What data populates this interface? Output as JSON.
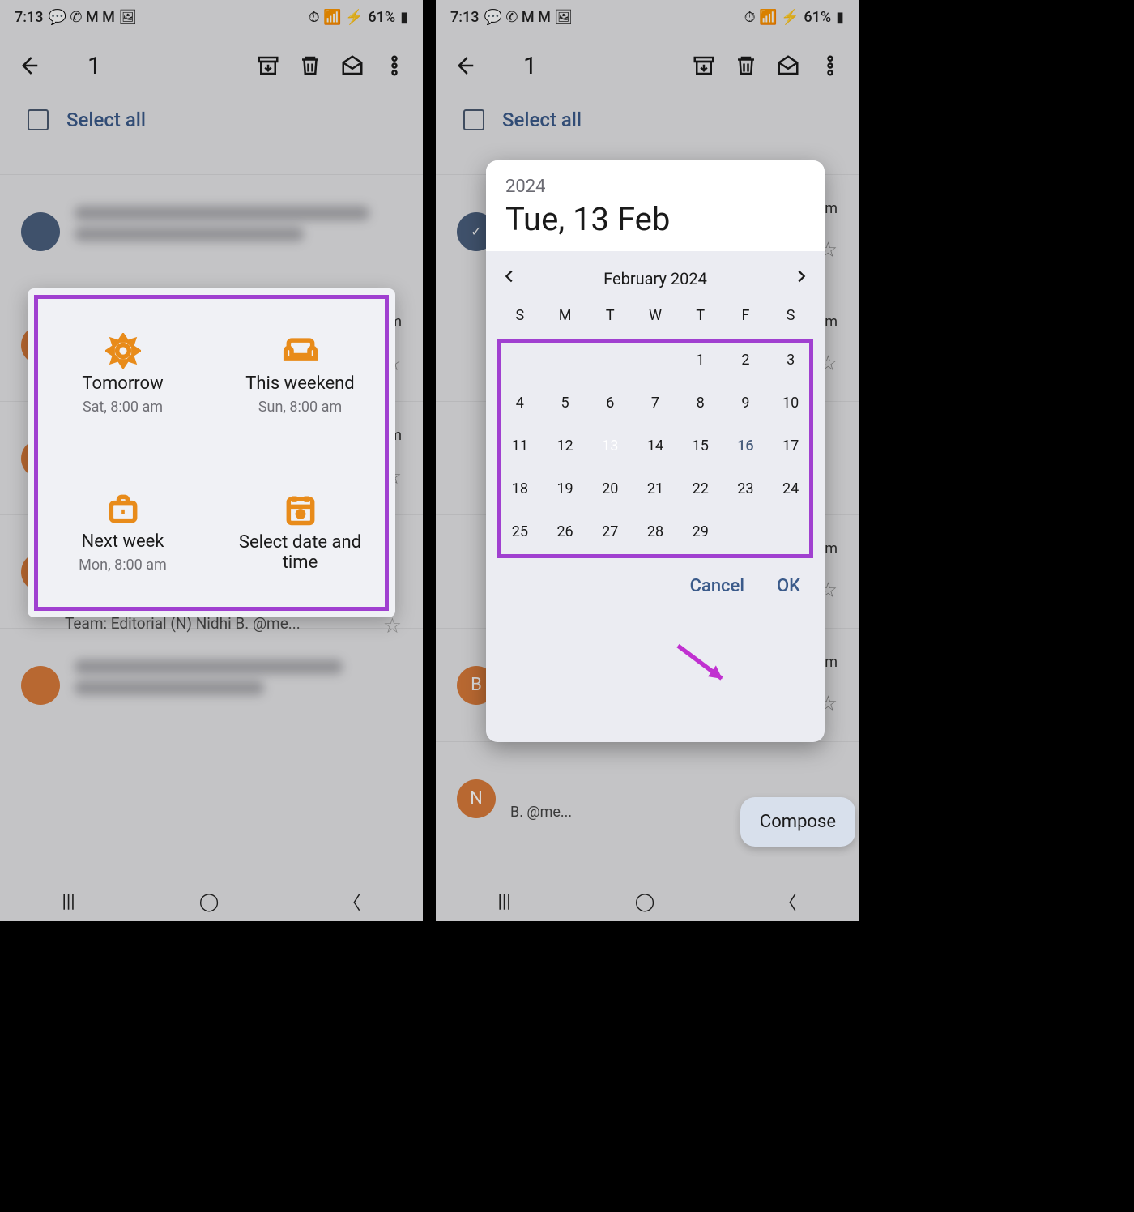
{
  "status": {
    "time": "7:13",
    "battery": "61%"
  },
  "toolbar": {
    "count": "1"
  },
  "select_all": "Select all",
  "snooze": {
    "opts": [
      {
        "title": "Tomorrow",
        "sub": "Sat, 8:00 am"
      },
      {
        "title": "This weekend",
        "sub": "Sun, 8:00 am"
      },
      {
        "title": "Next week",
        "sub": "Mon, 8:00 am"
      },
      {
        "title": "Select date and time",
        "sub": ""
      }
    ]
  },
  "picker": {
    "year": "2024",
    "date_str": "Tue, 13 Feb",
    "month_label": "February 2024",
    "dow": [
      "S",
      "M",
      "T",
      "W",
      "T",
      "F",
      "S"
    ],
    "weeks": [
      [
        "",
        "",
        "",
        "",
        "1",
        "2",
        "3"
      ],
      [
        "4",
        "5",
        "6",
        "7",
        "8",
        "9",
        "10"
      ],
      [
        "11",
        "12",
        "13",
        "14",
        "15",
        "16",
        "17"
      ],
      [
        "18",
        "19",
        "20",
        "21",
        "22",
        "23",
        "24"
      ],
      [
        "25",
        "26",
        "27",
        "28",
        "29",
        "",
        ""
      ]
    ],
    "selected": "13",
    "today": "16",
    "cancel": "Cancel",
    "ok": "OK"
  },
  "bg": {
    "team_text": "Team: Editorial (N) Nidhi B. @me...",
    "avatar_letters": [
      "B",
      "N"
    ],
    "time_pm": "pm",
    "suffix": "B. @me..."
  },
  "compose": "Compose"
}
